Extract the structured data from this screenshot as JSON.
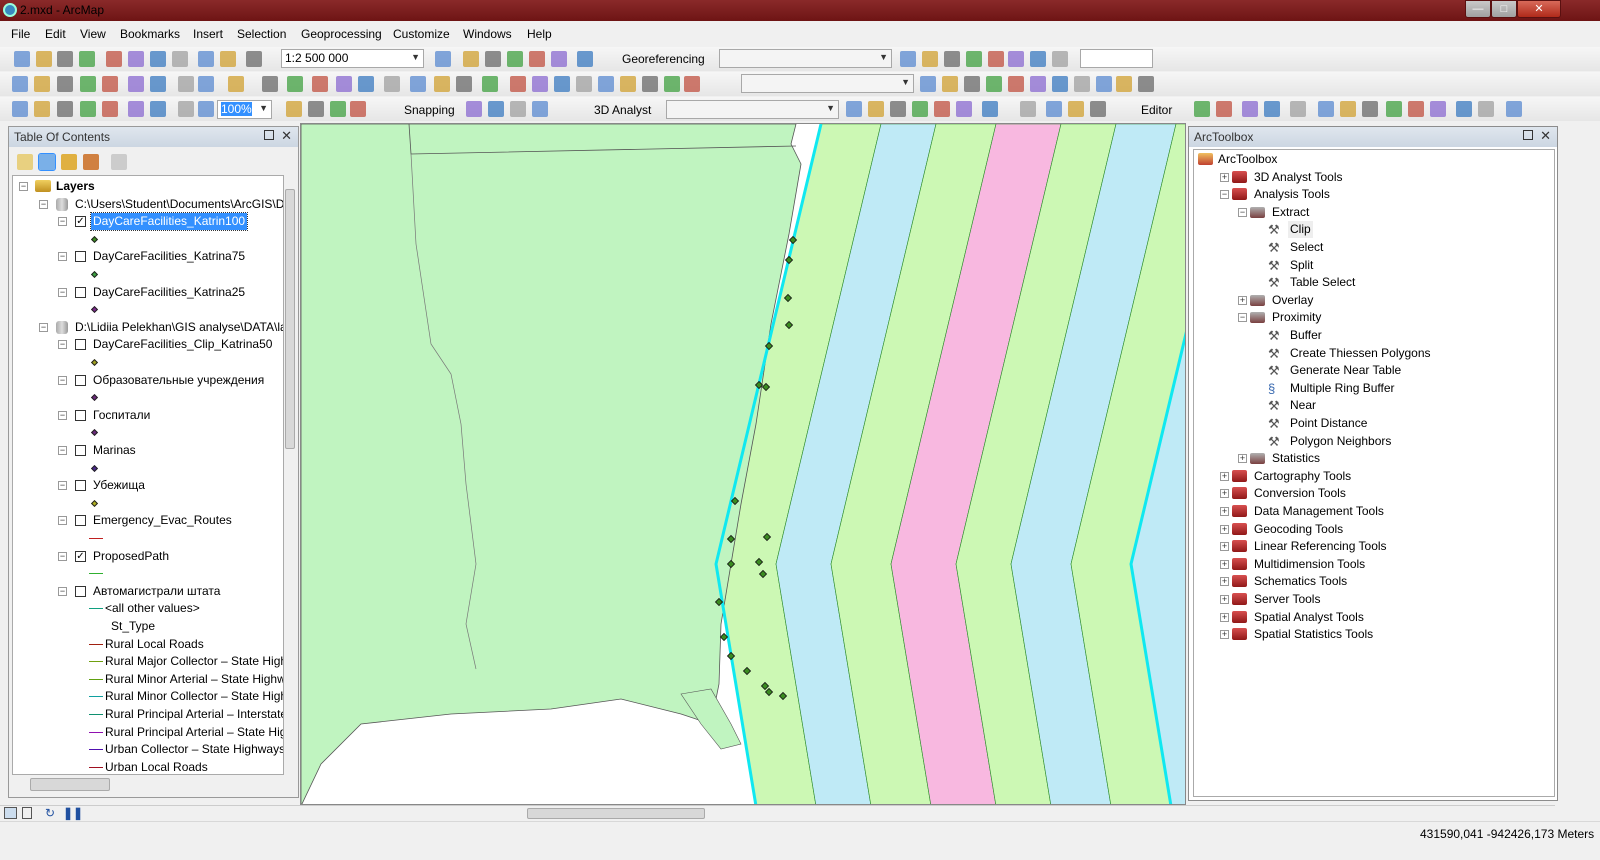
{
  "window": {
    "title": "2.mxd - ArcMap",
    "min": "—",
    "max": "□",
    "close": "✕"
  },
  "menu": [
    "File",
    "Edit",
    "View",
    "Bookmarks",
    "Insert",
    "Selection",
    "Geoprocessing",
    "Customize",
    "Windows",
    "Help"
  ],
  "toolbar": {
    "scale": "1:2 500 000",
    "zoom_percent": "100%",
    "georeferencing": "Georeferencing",
    "snapping": "Snapping",
    "analyst3d": "3D Analyst",
    "editor": "Editor"
  },
  "toc": {
    "title": "Table Of Contents",
    "items": [
      {
        "label": "Layers",
        "level": 0,
        "kind": "frame"
      },
      {
        "label": "C:\\Users\\Student\\Documents\\ArcGIS\\De",
        "level": 1,
        "kind": "db"
      },
      {
        "label": "DayCareFacilities_Katrin100",
        "level": 2,
        "kind": "layer",
        "checked": true,
        "selected": true,
        "sym": "dot",
        "color": "#3a8a20"
      },
      {
        "label": "DayCareFacilities_Katrina75",
        "level": 2,
        "kind": "layer",
        "checked": false,
        "sym": "dot",
        "color": "#3aa040"
      },
      {
        "label": "DayCareFacilities_Katrina25",
        "level": 2,
        "kind": "layer",
        "checked": false,
        "sym": "dot",
        "color": "#7a2a8a"
      },
      {
        "label": "D:\\Lidiia Pelekhan\\GIS analyse\\DATA\\lal",
        "level": 1,
        "kind": "db"
      },
      {
        "label": "DayCareFacilities_Clip_Katrina50",
        "level": 2,
        "kind": "layer",
        "checked": false,
        "sym": "dot",
        "color": "#a0a020"
      },
      {
        "label": "Образовательные учреждения",
        "level": 2,
        "kind": "layer",
        "checked": false,
        "sym": "dot",
        "color": "#6a2a7a"
      },
      {
        "label": "Госпитали",
        "level": 2,
        "kind": "layer",
        "checked": false,
        "sym": "dot",
        "color": "#6a2a7a"
      },
      {
        "label": "Marinas",
        "level": 2,
        "kind": "layer",
        "checked": false,
        "sym": "dot",
        "color": "#4a2a8a"
      },
      {
        "label": "Убежища",
        "level": 2,
        "kind": "layer",
        "checked": false,
        "sym": "dot",
        "color": "#b0b020"
      },
      {
        "label": "Emergency_Evac_Routes",
        "level": 2,
        "kind": "layer",
        "checked": false,
        "sym": "line",
        "color": "#c02020"
      },
      {
        "label": "ProposedPath",
        "level": 2,
        "kind": "layer",
        "checked": true,
        "sym": "line",
        "color": "#30b030"
      },
      {
        "label": "Автомагистрали штата",
        "level": 2,
        "kind": "layer",
        "checked": false,
        "sym": "none"
      }
    ],
    "legend": [
      {
        "label": "<all other values>",
        "color": "#10a080"
      },
      {
        "label": "St_Type",
        "color": ""
      },
      {
        "label": "Rural Local Roads",
        "color": "#a02010"
      },
      {
        "label": "Rural Major Collector – State High",
        "color": "#70a010"
      },
      {
        "label": "Rural Minor Arterial – State Highw",
        "color": "#60a010"
      },
      {
        "label": "Rural Minor Collector – State High",
        "color": "#10a0a0"
      },
      {
        "label": "Rural Principal Arterial – Interstate",
        "color": "#109070"
      },
      {
        "label": "Rural Principal Arterial – State Hig",
        "color": "#9010b0"
      },
      {
        "label": "Urban Collector – State Highways",
        "color": "#5010b0"
      },
      {
        "label": "Urban Local Roads",
        "color": "#a01020"
      }
    ]
  },
  "toolbox": {
    "title": "ArcToolbox",
    "items": [
      {
        "label": "ArcToolbox",
        "level": 0,
        "kind": "root"
      },
      {
        "label": "3D Analyst Tools",
        "level": 1,
        "kind": "box",
        "exp": "+"
      },
      {
        "label": "Analysis Tools",
        "level": 1,
        "kind": "box",
        "exp": "-"
      },
      {
        "label": "Extract",
        "level": 2,
        "kind": "set",
        "exp": "-"
      },
      {
        "label": "Clip",
        "level": 3,
        "kind": "tool",
        "hover": true
      },
      {
        "label": "Select",
        "level": 3,
        "kind": "tool"
      },
      {
        "label": "Split",
        "level": 3,
        "kind": "tool"
      },
      {
        "label": "Table Select",
        "level": 3,
        "kind": "tool"
      },
      {
        "label": "Overlay",
        "level": 2,
        "kind": "set",
        "exp": "+"
      },
      {
        "label": "Proximity",
        "level": 2,
        "kind": "set",
        "exp": "-"
      },
      {
        "label": "Buffer",
        "level": 3,
        "kind": "tool"
      },
      {
        "label": "Create Thiessen Polygons",
        "level": 3,
        "kind": "tool"
      },
      {
        "label": "Generate Near Table",
        "level": 3,
        "kind": "tool"
      },
      {
        "label": "Multiple Ring Buffer",
        "level": 3,
        "kind": "script"
      },
      {
        "label": "Near",
        "level": 3,
        "kind": "tool"
      },
      {
        "label": "Point Distance",
        "level": 3,
        "kind": "tool"
      },
      {
        "label": "Polygon Neighbors",
        "level": 3,
        "kind": "tool"
      },
      {
        "label": "Statistics",
        "level": 2,
        "kind": "set",
        "exp": "+"
      },
      {
        "label": "Cartography Tools",
        "level": 1,
        "kind": "box",
        "exp": "+"
      },
      {
        "label": "Conversion Tools",
        "level": 1,
        "kind": "box",
        "exp": "+"
      },
      {
        "label": "Data Management Tools",
        "level": 1,
        "kind": "box",
        "exp": "+"
      },
      {
        "label": "Geocoding Tools",
        "level": 1,
        "kind": "box",
        "exp": "+"
      },
      {
        "label": "Linear Referencing Tools",
        "level": 1,
        "kind": "box",
        "exp": "+"
      },
      {
        "label": "Multidimension Tools",
        "level": 1,
        "kind": "box",
        "exp": "+"
      },
      {
        "label": "Schematics Tools",
        "level": 1,
        "kind": "box",
        "exp": "+"
      },
      {
        "label": "Server Tools",
        "level": 1,
        "kind": "box",
        "exp": "+"
      },
      {
        "label": "Spatial Analyst Tools",
        "level": 1,
        "kind": "box",
        "exp": "+"
      },
      {
        "label": "Spatial Statistics Tools",
        "level": 1,
        "kind": "box",
        "exp": "+"
      }
    ]
  },
  "map": {
    "land": "#c0f4c0",
    "band_green": "#ccf8b4",
    "band_blue": "#bfeaf6",
    "band_pink": "#f8b8e0",
    "coast": "#10e8f0"
  },
  "status": {
    "coords": "431590,041  -942426,173 Meters"
  }
}
